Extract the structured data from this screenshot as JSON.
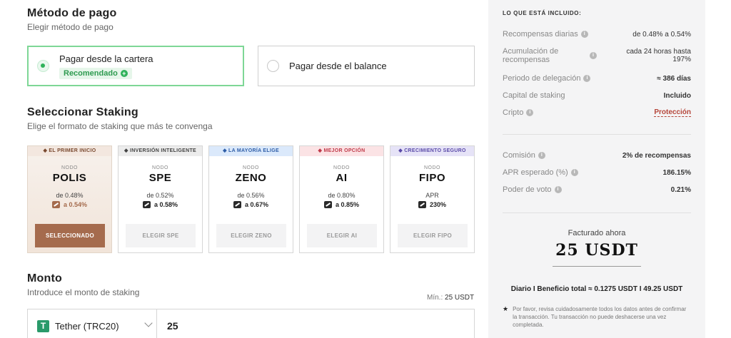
{
  "payment": {
    "title": "Método de pago",
    "subtitle": "Elegir método de pago",
    "option_wallet": "Pagar desde la cartera",
    "recommended": "Recomendado",
    "option_balance": "Pagar desde el balance"
  },
  "staking": {
    "title": "Seleccionar Staking",
    "subtitle": "Elige el formato de staking que más te convenga",
    "node_label": "NODO",
    "cards": [
      {
        "tag": "EL PRIMER INICIO",
        "tag_color": "#f3e7df",
        "tag_text": "#7a4a30",
        "name": "POLIS",
        "from": "de 0.48%",
        "to": "a 0.54%",
        "button": "SELECCIONADO",
        "selected": true
      },
      {
        "tag": "INVERSIÓN INTELIGENTE",
        "tag_color": "#ececec",
        "tag_text": "#444",
        "name": "SPE",
        "from": "de 0.52%",
        "to": "a 0.58%",
        "button": "ELEGIR SPE",
        "selected": false
      },
      {
        "tag": "LA MAYORÍA ELIGE",
        "tag_color": "#dbe9fb",
        "tag_text": "#2f5ea8",
        "name": "ZENO",
        "from": "de 0.56%",
        "to": "a 0.67%",
        "button": "ELEGIR ZENO",
        "selected": false
      },
      {
        "tag": "MEJOR OPCIÓN",
        "tag_color": "#fbe3e5",
        "tag_text": "#c03a4a",
        "name": "AI",
        "from": "de 0.80%",
        "to": "a 0.85%",
        "button": "ELEGIR AI",
        "selected": false
      },
      {
        "tag": "CRECIMIENTO SEGURO",
        "tag_color": "#e6e3f7",
        "tag_text": "#5a4aa8",
        "name": "FIPO",
        "from": "APR",
        "to": "230%",
        "button": "ELEGIR FIPO",
        "selected": false
      }
    ]
  },
  "amount": {
    "title": "Monto",
    "subtitle": "Introduce el monto de staking",
    "min_label": "Mín.:",
    "min_value": "25 USDT",
    "coin_symbol": "T",
    "coin": "Tether (TRC20)",
    "value": "25"
  },
  "summary": {
    "heading": "LO QUE ESTÁ INCLUIDO:",
    "rows": [
      {
        "label": "Recompensas diarias",
        "value": "de 0.48% a 0.54%"
      },
      {
        "label": "Acumulación de recompensas",
        "value": "cada 24 horas hasta 197%"
      },
      {
        "label": "Periodo de delegación",
        "value": "≈ 386 días"
      },
      {
        "label": "Capital de staking",
        "value": "Incluido"
      },
      {
        "label": "Cripto",
        "value": "Protección"
      }
    ],
    "rows2": [
      {
        "label": "Comisión",
        "value": "2% de recompensas"
      },
      {
        "label": "APR esperado (%)",
        "value": "186.15%"
      },
      {
        "label": "Poder de voto",
        "value": "0.21%"
      }
    ],
    "billed_label": "Facturado ahora",
    "billed_value": "25 USDT",
    "daily": "Diario I Beneficio total ≈ 0.1275 USDT I 49.25 USDT",
    "note": "Por favor, revisa cuidadosamente todos los datos antes de confirmar la transacción. Tu transacción no puede deshacerse una vez completada."
  }
}
